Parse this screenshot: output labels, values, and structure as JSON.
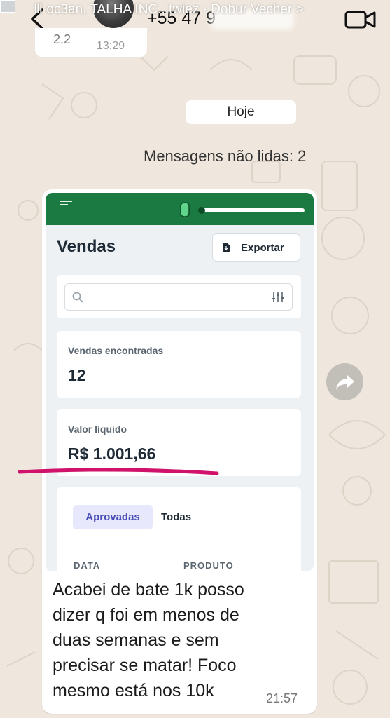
{
  "story_overlay": {
    "text": "Ⅲ oc3an, TALHA INC., twiez · Dobur Vecher >"
  },
  "header": {
    "phone": "+55 47 9",
    "icons": {
      "back": "arrow-left-icon",
      "video": "video-camera-icon"
    }
  },
  "previous_message": {
    "text": "2.2",
    "time": "13:29"
  },
  "date_chip": "Hoje",
  "unread_banner": "Mensagens não lidas: 2",
  "message": {
    "screenshot": {
      "title": "Vendas",
      "export_label": "Exportar",
      "search_placeholder": "",
      "stats": [
        {
          "label": "Vendas encontradas",
          "value": "12"
        },
        {
          "label": "Valor líquido",
          "value": "R$ 1.001,66"
        }
      ],
      "tabs": {
        "approved": "Aprovadas",
        "all": "Todas"
      },
      "columns": [
        "DATA",
        "PRODUTO"
      ]
    },
    "caption": "Acabei de bate 1k posso dizer q foi em menos de duas semanas e sem precisar se matar! Foco mesmo está nos 10k",
    "time": "21:57"
  },
  "colors": {
    "chat_background": "#efe7dd",
    "bubble": "#ffffff",
    "app_bar": "#1a7a41",
    "approved_tab": "#e7e8fb",
    "annotation": "#d0126a"
  }
}
